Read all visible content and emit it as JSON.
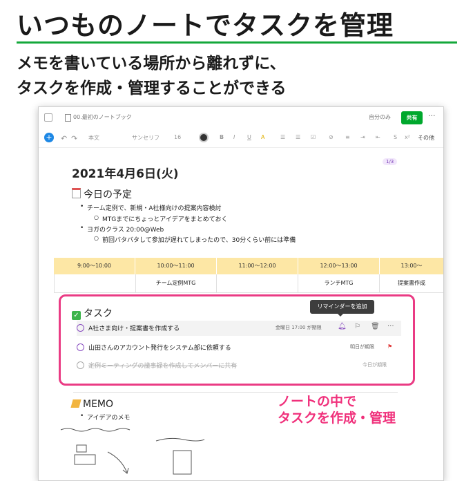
{
  "headline": "いつものノートでタスクを管理",
  "subline1": "メモを書いている場所から離れずに、",
  "subline2": "タスクを作成・管理することができる",
  "window": {
    "notebook_title": "00.最初のノートブック",
    "sharing_label": "自分のみ",
    "share_button": "共有",
    "more": "···"
  },
  "toolbar": {
    "add": "+",
    "undo": "↶",
    "redo": "↷",
    "style": "本文",
    "font": "サンセリフ",
    "size": "16",
    "bold": "B",
    "italic": "I",
    "underline": "U",
    "highlight": "A",
    "more_label": "その他"
  },
  "note": {
    "date": "2021年4月6日(火)",
    "badge": "1/3",
    "schedule_title": "今日の予定",
    "bullets": [
      {
        "text": "チーム定例で、新規・A社様向けの提案内容検討",
        "level": 1
      },
      {
        "text": "MTGまでにちょっとアイデアをまとめておく",
        "level": 2
      },
      {
        "text": "ヨガのクラス 20:00@Web",
        "level": 1
      },
      {
        "text": "前回バタバタして参加が遅れてしまったので、30分くらい前には準備",
        "level": 2
      }
    ]
  },
  "schedule": {
    "times": [
      "9:00〜10:00",
      "10:00〜11:00",
      "11:00〜12:00",
      "12:00〜13:00",
      "13:00〜"
    ],
    "events": [
      "",
      "チーム定例MTG",
      "",
      "ランチMTG",
      "提案書作成"
    ]
  },
  "tasks": {
    "title": "タスク",
    "tooltip": "リマインダーを追加",
    "items": [
      {
        "label": "A社さま向け・提案書を作成する",
        "due": "金曜日 17:00 が期限",
        "done": false
      },
      {
        "label": "山田さんのアカウント発行をシステム部に依頼する",
        "due": "明日が期限",
        "done": false
      },
      {
        "label": "定例ミーティングの議事録を作成してメンバーに共有",
        "due": "今日が期限",
        "done": true
      }
    ]
  },
  "memo": {
    "title": "MEMO",
    "bullet": "アイデアのメモ"
  },
  "annotation": {
    "line1": "ノートの中で",
    "line2": "タスクを作成・管理"
  },
  "colors": {
    "accent_green": "#14a83b",
    "highlight_pink": "#ea3b84",
    "schedule_header": "#fde7a5"
  }
}
